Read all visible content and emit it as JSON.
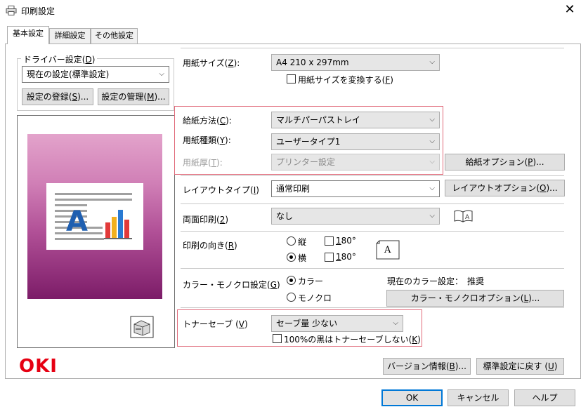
{
  "window": {
    "title": "印刷設定",
    "close_glyph": "✕"
  },
  "tabs": [
    {
      "label": "基本設定",
      "active": true
    },
    {
      "label": "詳細設定",
      "active": false
    },
    {
      "label": "その他設定",
      "active": false
    }
  ],
  "driver": {
    "group_label": "ドライバー設定(",
    "group_key": "D",
    "group_end": ")",
    "selected": "現在の設定(標準設定)",
    "register_label": "設定の登録(",
    "register_key": "S",
    "register_end": ")...",
    "manage_label": "設定の管理(",
    "manage_key": "M",
    "manage_end": ")..."
  },
  "paper_size": {
    "label": "用紙サイズ(",
    "key": "Z",
    "end": "):",
    "value": "A4 210 x 297mm",
    "convert_label": "用紙サイズを変換する(",
    "convert_key": "F",
    "convert_end": ")",
    "convert_checked": false
  },
  "feed": {
    "method_label": "給紙方法(",
    "method_key": "C",
    "method_end": "):",
    "method_value": "マルチパーパストレイ",
    "type_label": "用紙種類(",
    "type_key": "Y",
    "type_end": "):",
    "type_value": "ユーザータイプ1",
    "weight_label": "用紙厚(",
    "weight_key": "T",
    "weight_end": "):",
    "weight_value": "プリンター設定",
    "options_label": "給紙オプション(",
    "options_key": "P",
    "options_end": ")..."
  },
  "layout": {
    "label": "レイアウトタイプ(",
    "key": "I",
    "end": ")",
    "value": "通常印刷",
    "options_label": "レイアウトオプション(",
    "options_key": "O",
    "options_end": ")..."
  },
  "duplex": {
    "label": "両面印刷(",
    "key": "2",
    "end": ")",
    "value": "なし"
  },
  "orientation": {
    "label": "印刷の向き(",
    "key": "R",
    "end": ")",
    "portrait": "縦",
    "landscape": "横",
    "selected": "横",
    "rotate_label": "180°",
    "rotate_key": "1",
    "rotate_rest": "80°",
    "preview_letter": "A"
  },
  "color": {
    "label": "カラー・モノクロ設定(",
    "key": "G",
    "end": ")",
    "color_option": "カラー",
    "mono_option": "モノクロ",
    "selected": "カラー",
    "current_label": "現在のカラー設定：",
    "current_value": "推奨",
    "options_label": "カラー・モノクロオプション(",
    "options_key": "L",
    "options_end": ")..."
  },
  "toner": {
    "label": "トナーセーブ (",
    "key": "V",
    "end": ")",
    "value": "セーブ量 少ない",
    "no_save_black_label": "100%の黒はトナーセーブしない(",
    "no_save_black_key": "K",
    "no_save_black_end": ")",
    "no_save_black_checked": false
  },
  "footer": {
    "brand": "OKI",
    "version_label": "バージョン情報(",
    "version_key": "B",
    "version_end": ")...",
    "default_label": "標準設定に戻す (",
    "default_key": "U",
    "default_end": ")",
    "ok_label": "OK",
    "cancel_label": "キャンセル",
    "help_label": "ヘルプ"
  },
  "preview": {
    "doc_letter": "A"
  },
  "colors": {
    "highlight_box": "#e06a7a",
    "oki_red": "#e60012",
    "ok_border": "#0078d7"
  }
}
